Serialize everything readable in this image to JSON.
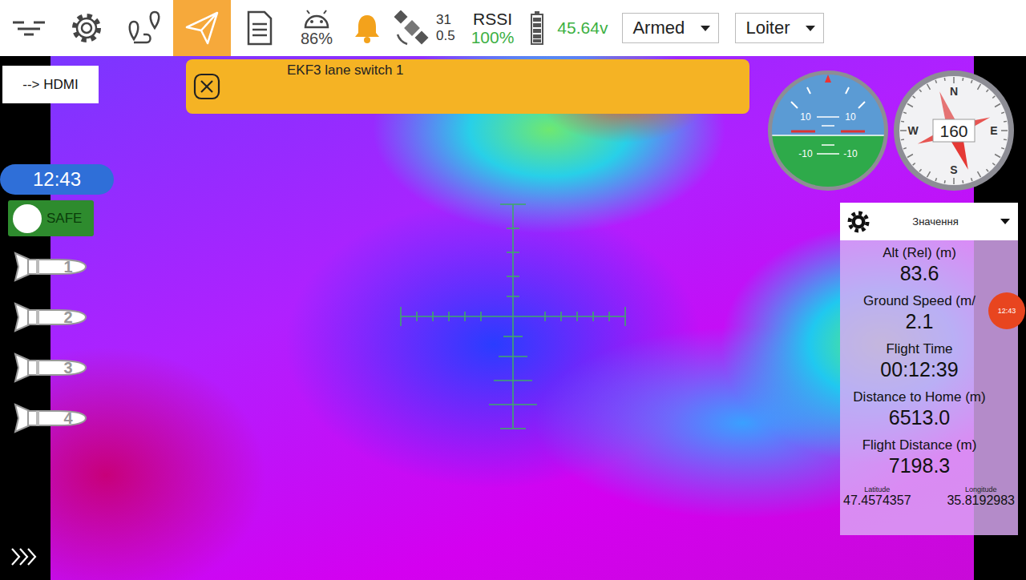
{
  "toolbar": {
    "nav_buttons": [
      {
        "kind": "menu",
        "selected": false
      },
      {
        "kind": "settings",
        "selected": false
      },
      {
        "kind": "plan",
        "selected": false
      },
      {
        "kind": "fly",
        "selected": true
      },
      {
        "kind": "log",
        "selected": false
      }
    ],
    "phone_battery": "86%",
    "alert": true,
    "gps_sats": "31",
    "hdop": "0.5",
    "rssi_label": "RSSI",
    "rssi": "100%",
    "voltage": "45.64v",
    "arm_dropdown": "Armed",
    "mode_dropdown": "Loiter"
  },
  "message": {
    "text": "EKF3 lane switch 1"
  },
  "hdmi_button": "--> HDMI",
  "clock": "12:43",
  "safety": {
    "label": "SAFE",
    "on": false
  },
  "payload_buttons": [
    "1",
    "2",
    "3",
    "4"
  ],
  "attitude": {
    "pitch_labels": [
      "10",
      "10",
      "-10",
      "-10"
    ]
  },
  "compass": {
    "heading": "160",
    "north": "N",
    "east": "E",
    "south": "S",
    "west": "W"
  },
  "values_panel": {
    "title": "Значення",
    "items": [
      {
        "label": "Alt (Rel) (m)",
        "value": "83.6"
      },
      {
        "label": "Ground Speed (m/",
        "value": "2.1"
      },
      {
        "label": "Flight Time",
        "value": "00:12:39"
      },
      {
        "label": "Distance to Home (m)",
        "value": "6513.0"
      },
      {
        "label": "Flight Distance (m)",
        "value": "7198.3"
      }
    ],
    "latitude_label": "Latitude",
    "latitude": "47.4574357",
    "longitude_label": "Longitude",
    "longitude": "35.8192983"
  },
  "badge": "12:43"
}
